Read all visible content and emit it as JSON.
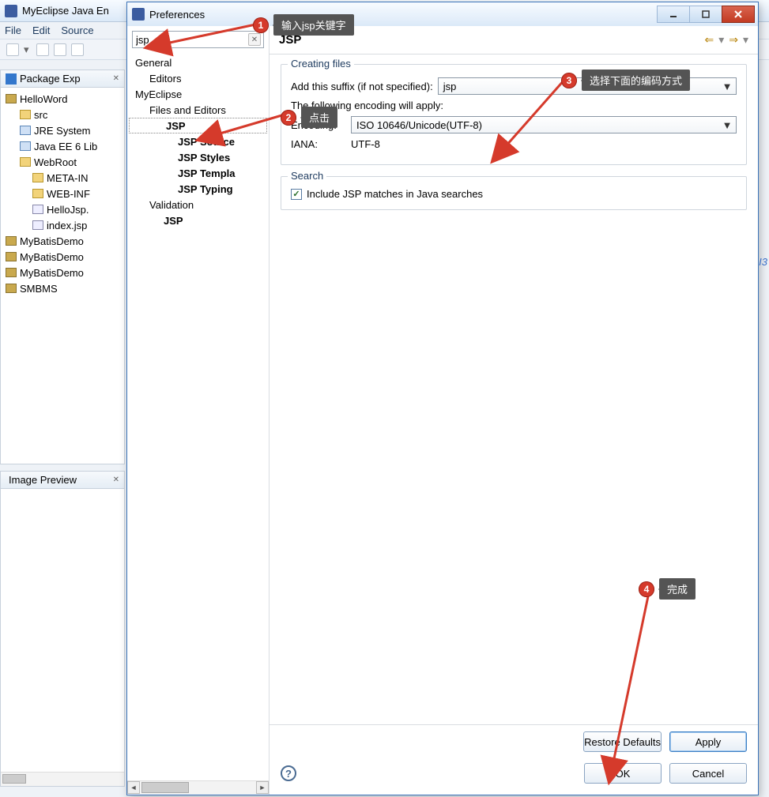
{
  "eclipse": {
    "title": "MyEclipse Java En",
    "menu": [
      "File",
      "Edit",
      "Source"
    ]
  },
  "package_explorer": {
    "title": "Package Exp",
    "items": [
      {
        "label": "HelloWord",
        "icon": "proj",
        "indent": 0
      },
      {
        "label": "src",
        "icon": "fold",
        "indent": 1
      },
      {
        "label": "JRE System",
        "icon": "lib",
        "indent": 1
      },
      {
        "label": "Java EE 6 Lib",
        "icon": "lib",
        "indent": 1
      },
      {
        "label": "WebRoot",
        "icon": "fold",
        "indent": 1
      },
      {
        "label": "META-IN",
        "icon": "fold",
        "indent": 2
      },
      {
        "label": "WEB-INF",
        "icon": "fold",
        "indent": 2
      },
      {
        "label": "HelloJsp.",
        "icon": "file",
        "indent": 2
      },
      {
        "label": "index.jsp",
        "icon": "file",
        "indent": 2
      },
      {
        "label": "MyBatisDemo",
        "icon": "proj",
        "indent": 0
      },
      {
        "label": "MyBatisDemo",
        "icon": "proj",
        "indent": 0
      },
      {
        "label": "MyBatisDemo",
        "icon": "proj",
        "indent": 0
      },
      {
        "label": "SMBMS",
        "icon": "proj",
        "indent": 0
      }
    ]
  },
  "image_preview": {
    "title": "Image Preview"
  },
  "preferences": {
    "title": "Preferences",
    "filter_value": "jsp",
    "tree": [
      {
        "label": "General",
        "indent": 0,
        "bold": false
      },
      {
        "label": "Editors",
        "indent": 1,
        "bold": false
      },
      {
        "label": "MyEclipse",
        "indent": 0,
        "bold": false
      },
      {
        "label": "Files and Editors",
        "indent": 1,
        "bold": false
      },
      {
        "label": "JSP",
        "indent": 2,
        "bold": true,
        "selected": true
      },
      {
        "label": "JSP Source",
        "indent": 3,
        "bold": true
      },
      {
        "label": "JSP Styles",
        "indent": 3,
        "bold": true
      },
      {
        "label": "JSP Templa",
        "indent": 3,
        "bold": true
      },
      {
        "label": "JSP Typing",
        "indent": 3,
        "bold": true
      },
      {
        "label": "Validation",
        "indent": 1,
        "bold": false
      },
      {
        "label": "JSP",
        "indent": 2,
        "bold": true
      }
    ],
    "page_title": "JSP",
    "group_creating": {
      "legend": "Creating files",
      "suffix_label": "Add this suffix (if not specified):",
      "suffix_value": "jsp",
      "apply_label": "The following encoding will apply:",
      "encoding_label": "Encoding:",
      "encoding_value": "ISO 10646/Unicode(UTF-8)",
      "iana_label": "IANA:",
      "iana_value": "UTF-8"
    },
    "group_search": {
      "legend": "Search",
      "checkbox_label": "Include JSP matches in Java searches",
      "checked": true
    },
    "buttons": {
      "restore": "Restore Defaults",
      "apply": "Apply",
      "ok": "OK",
      "cancel": "Cancel"
    }
  },
  "annotations": {
    "c1": {
      "num": "1",
      "text": "输入jsp关键字"
    },
    "c2": {
      "num": "2",
      "text": "点击"
    },
    "c3": {
      "num": "3",
      "text": "选择下面的编码方式"
    },
    "c4": {
      "num": "4",
      "text": "完成"
    }
  },
  "aux_text": {
    "m3": "I3"
  }
}
